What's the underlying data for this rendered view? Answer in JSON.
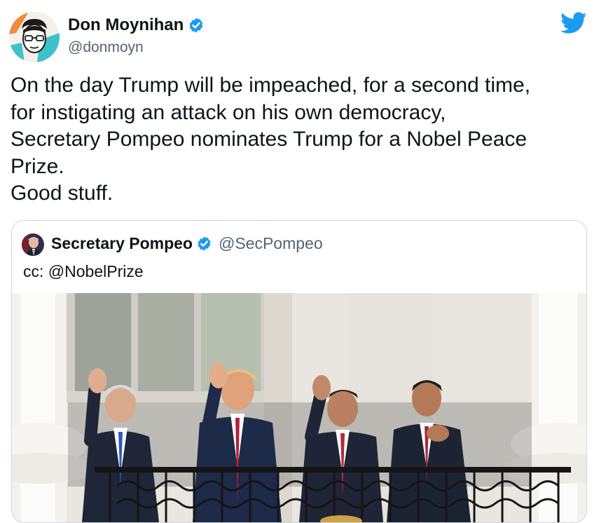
{
  "tweet": {
    "display_name": "Don Moynihan",
    "handle": "@donmoyn",
    "text": "On the day Trump will be impeached, for a second time,\nfor instigating an attack on his own democracy,\nSecretary Pompeo nominates Trump for a Nobel Peace\nPrize.\nGood stuff.",
    "verified": true
  },
  "quoted_tweet": {
    "display_name": "Secretary Pompeo",
    "handle": "@SecPompeo",
    "text": "cc: @NobelPrize",
    "verified": true
  },
  "icons": {
    "brand": "twitter-bird-icon",
    "verified": "verified-badge-icon"
  },
  "colors": {
    "brand_blue": "#1d9bf0",
    "text_primary": "#0f1419",
    "text_secondary": "#536471",
    "border": "#cfd9de"
  }
}
